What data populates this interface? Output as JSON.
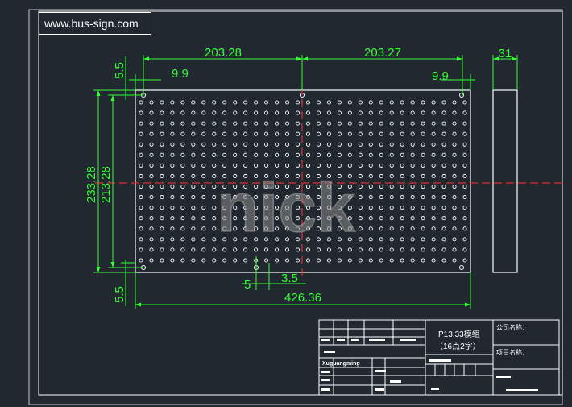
{
  "header": {
    "website": "www.bus-sign.com"
  },
  "watermark": {
    "text": "nick"
  },
  "colors": {
    "background": "#212830",
    "dimension": "#33ff33",
    "outline": "#ffffff",
    "centerline": "#ff3333"
  },
  "dimensions": {
    "top_left_span": "203.28",
    "top_right_span": "203.27",
    "hole_offset_left": "9.9",
    "hole_offset_right": "9.9",
    "edge_top": "5.5",
    "edge_bottom": "5.5",
    "total_height": "233.28",
    "hole_span_height": "213.28",
    "thickness": "31",
    "bottom_offset_a": "5",
    "bottom_offset_b": "3.5",
    "total_width": "426.36"
  },
  "title_block": {
    "module_name": "P13.33模组",
    "module_spec": "（16点2字）",
    "company_label": "公司名称：",
    "project_label": "项目名称：",
    "designer": "Xuguangming"
  }
}
